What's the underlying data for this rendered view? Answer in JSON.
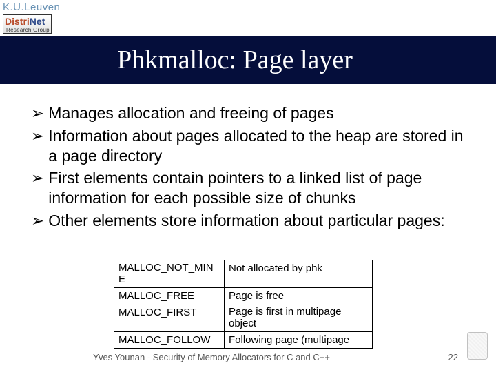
{
  "logo": {
    "university": "K.U.Leuven",
    "group_colored_a": "Distri",
    "group_colored_b": "Net",
    "group_sub": "Research Group"
  },
  "title": "Phkmalloc: Page layer",
  "bullets": [
    "Manages allocation and freeing of pages",
    "Information about pages allocated to the heap are stored in a page directory",
    "First elements contain pointers to a linked list of page information for each possible size of chunks",
    "Other elements store information about particular pages:"
  ],
  "table": {
    "rows": [
      {
        "name_a": "MALLOC_NOT_MIN",
        "name_b": "E",
        "desc": "Not allocated by phk"
      },
      {
        "name": "MALLOC_FREE",
        "desc": "Page is free"
      },
      {
        "name": "MALLOC_FIRST",
        "desc_a": "Page is first in multipage",
        "desc_b": "object"
      },
      {
        "name": "MALLOC_FOLLOW",
        "desc": "Following page (multipage"
      }
    ]
  },
  "footer": {
    "author": "Yves Younan - Security of Memory Allocators for C and C++",
    "page": "22"
  },
  "glyphs": {
    "bullet_arrow": "➢"
  }
}
